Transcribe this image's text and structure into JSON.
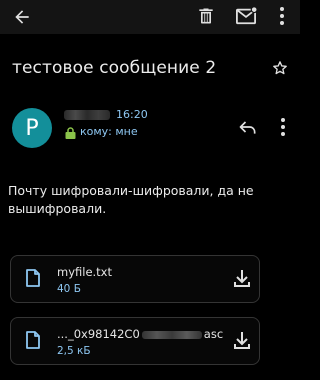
{
  "toolbar": {
    "back_icon": "arrow-left-icon",
    "delete_icon": "trash-icon",
    "mark_unread_icon": "mail-icon",
    "more_icon": "more-vert-icon"
  },
  "message": {
    "subject": "тестовое сообщение 2",
    "sender_initial": "P",
    "time": "16:20",
    "recipient": "кому: мне",
    "body": "Почту шифровали-шифровали, да не вышифровали."
  },
  "attachments": [
    {
      "name": "myfile.txt",
      "size": "40 Б"
    },
    {
      "name_prefix": "..._0x98142C0",
      "name_suffix": "asc",
      "size": "2,5 кБ"
    }
  ],
  "colors": {
    "accent": "#8ec7f2",
    "avatar": "#138f9a",
    "lock": "#8bc34a",
    "background": "#000000"
  }
}
